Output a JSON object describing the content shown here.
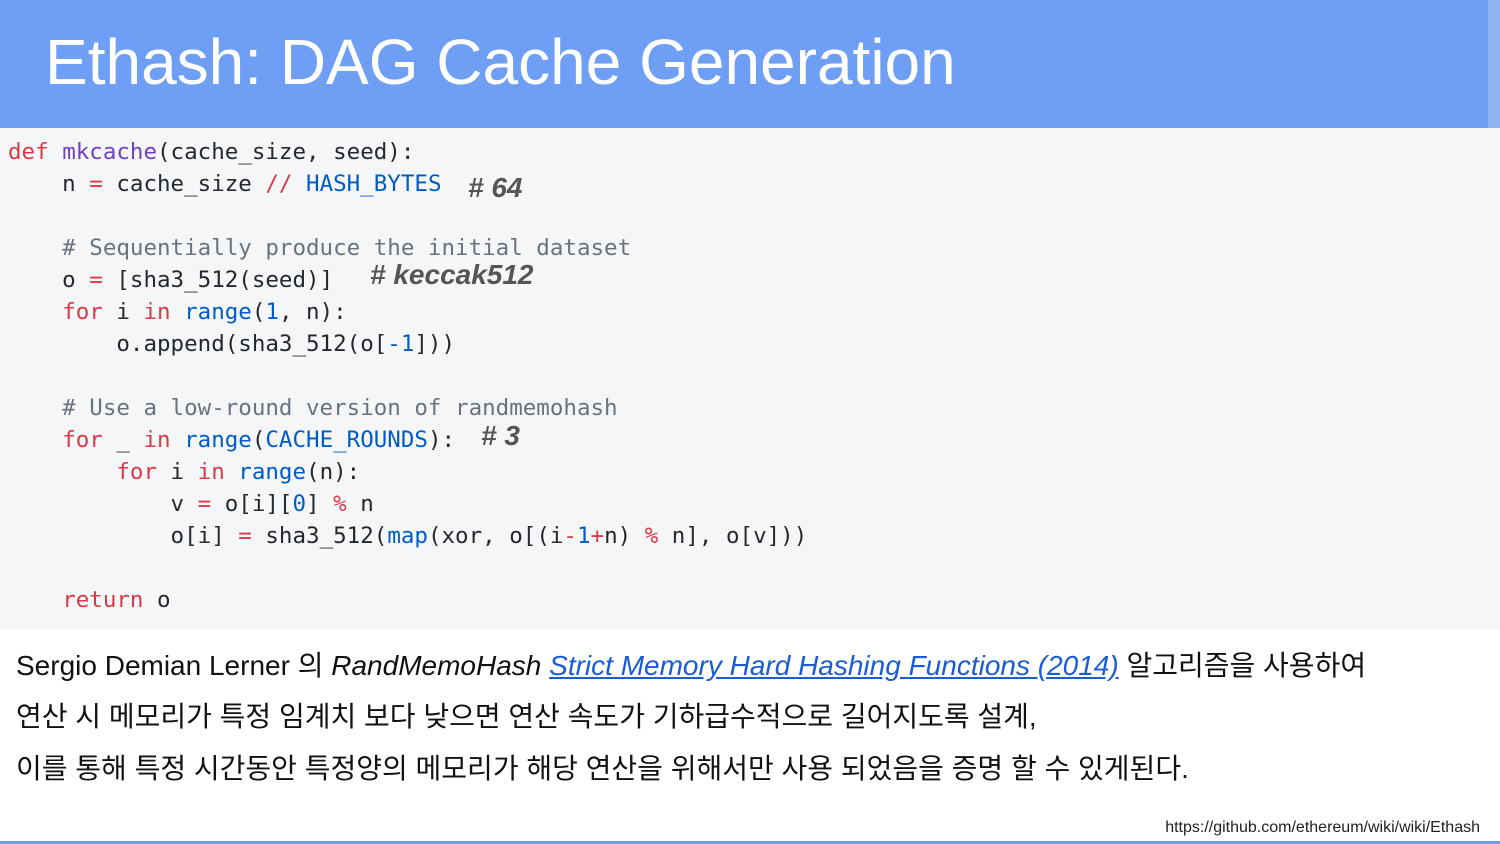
{
  "slide": {
    "title": "Ethash: DAG Cache Generation"
  },
  "code": {
    "def_kw": "def",
    "func_name": "mkcache",
    "line1_rest": "(cache_size, seed):",
    "l2_a": "    n ",
    "l2_eq": "=",
    "l2_b": " cache_size ",
    "l2_op": "//",
    "l2_sp": " ",
    "l2_const": "HASH_BYTES",
    "comment1": "    # Sequentially produce the initial dataset",
    "l5_a": "    o ",
    "l5_eq": "=",
    "l5_b": " [sha3_512(seed)]",
    "l6_pre": "    ",
    "l6_for": "for",
    "l6_i": " i ",
    "l6_in": "in",
    "l6_sp": " ",
    "l6_range": "range",
    "l6_p": "(",
    "l6_one": "1",
    "l6_rest": ", n):",
    "l7_a": "        o.append(sha3_512(o[",
    "l7_neg": "-1",
    "l7_b": "]))",
    "comment2": "    # Use a low-round version of randmemohash",
    "l10_pre": "    ",
    "l10_for": "for",
    "l10_u": " _ ",
    "l10_in": "in",
    "l10_sp": " ",
    "l10_range": "range",
    "l10_p": "(",
    "l10_const": "CACHE_ROUNDS",
    "l10_rest": "):",
    "l11_pre": "        ",
    "l11_for": "for",
    "l11_i": " i ",
    "l11_in": "in",
    "l11_sp": " ",
    "l11_range": "range",
    "l11_rest": "(n):",
    "l12_a": "            v ",
    "l12_eq": "=",
    "l12_b": " o[i][",
    "l12_zero": "0",
    "l12_c": "] ",
    "l12_mod": "%",
    "l12_d": " n",
    "l13_a": "            o[i] ",
    "l13_eq": "=",
    "l13_b": " sha3_512(",
    "l13_map": "map",
    "l13_c": "(xor, o[(i",
    "l13_minus": "-",
    "l13_one": "1",
    "l13_plus": "+",
    "l13_d": "n) ",
    "l13_mod": "%",
    "l13_e": " n], o[v]))",
    "l15_pre": "    ",
    "l15_return": "return",
    "l15_rest": " o"
  },
  "notes": {
    "hash_bytes": "# 64",
    "sha3": "# keccak512",
    "rounds": "# 3"
  },
  "description": {
    "author": "Sergio Demian Lerner ",
    "particle": "의 ",
    "algo": "RandMemoHash",
    "space": " ",
    "link_text": "Strict Memory Hard Hashing Functions (2014)",
    "line1_rest": " 알고리즘을 사용하여",
    "line2": "연산 시 메모리가 특정 임계치 보다 낮으면 연산 속도가 기하급수적으로 길어지도록 설계,",
    "line3": "이를 통해 특정 시간동안 특정양의 메모리가 해당 연산을 위해서만 사용 되었음을 증명 할 수 있게된다."
  },
  "source_url": "https://github.com/ethereum/wiki/wiki/Ethash",
  "colors": {
    "header_bg": "#6f9ff5",
    "code_bg": "#f5f6f8",
    "keyword": "#d73a49",
    "function": "#6f42c1",
    "builtin": "#005cc5",
    "comment": "#6a737d",
    "link": "#1a5bd6"
  }
}
